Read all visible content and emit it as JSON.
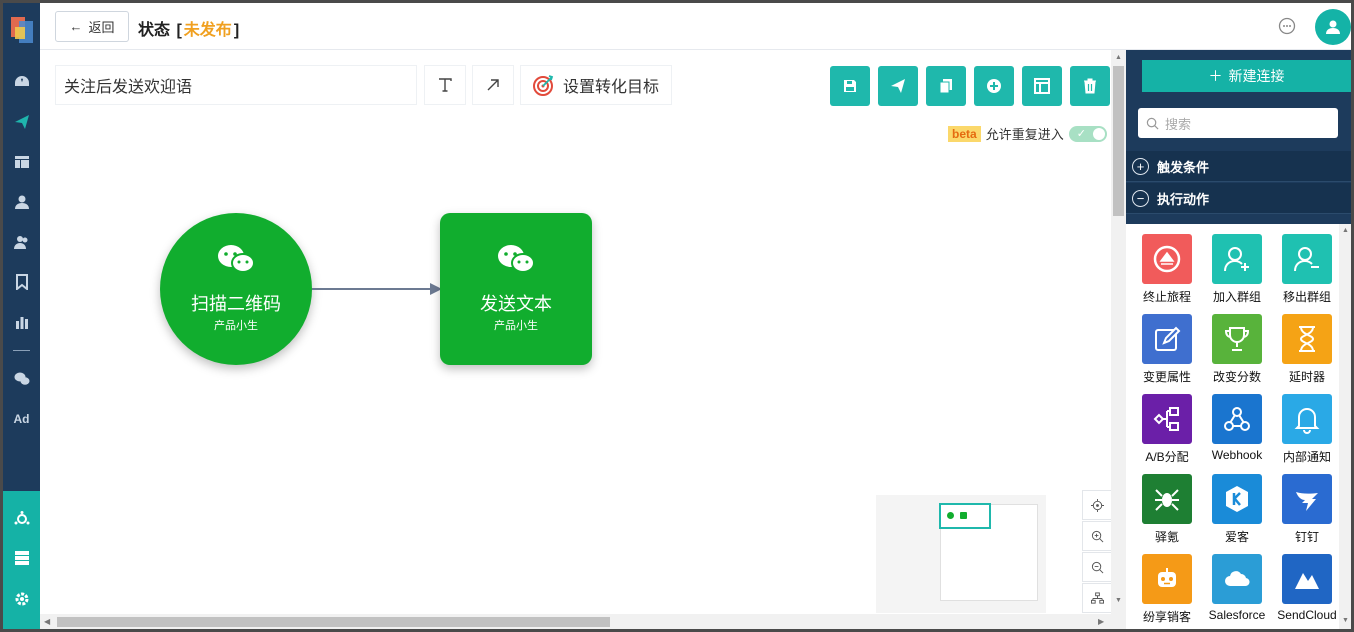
{
  "topbar": {
    "back_label": "返回",
    "status_label": "状态",
    "status_value": "未发布",
    "bracket_open": "[",
    "bracket_close": "]"
  },
  "nav": {
    "icons": [
      "dashboard-icon",
      "send-icon",
      "layout-icon",
      "user-icon",
      "users-icon",
      "bookmark-icon",
      "bar-chart-icon",
      "wechat-icon",
      "ad-icon",
      "connections-icon",
      "server-icon",
      "gear-icon"
    ],
    "ad_label": "Ad"
  },
  "canvas": {
    "flow_name": "关注后发送欢迎语",
    "goal_label": "设置转化目标",
    "beta_label": "beta",
    "reentry_label": "允许重复进入",
    "reentry_enabled": true,
    "nodes": [
      {
        "title": "扫描二维码",
        "subtitle": "产品小生",
        "shape": "circle"
      },
      {
        "title": "发送文本",
        "subtitle": "产品小生",
        "shape": "rect"
      }
    ],
    "toolbar_icons": [
      "save-icon",
      "publish-icon",
      "copy-icon",
      "add-icon",
      "template-icon",
      "delete-icon"
    ]
  },
  "right_panel": {
    "new_connection_label": "新建连接",
    "search_placeholder": "搜索",
    "sections": [
      {
        "label": "触发条件",
        "sign": "+"
      },
      {
        "label": "执行动作",
        "sign": "−"
      }
    ],
    "actions": [
      {
        "label": "终止旅程",
        "color": "#f15b5b",
        "icon": "stop-icon"
      },
      {
        "label": "加入群组",
        "color": "#1fc1b1",
        "icon": "user-add-icon"
      },
      {
        "label": "移出群组",
        "color": "#1fc1b1",
        "icon": "user-remove-icon"
      },
      {
        "label": "变更属性",
        "color": "#3f6fcf",
        "icon": "edit-icon"
      },
      {
        "label": "改变分数",
        "color": "#58b33b",
        "icon": "trophy-icon"
      },
      {
        "label": "延时器",
        "color": "#f5a315",
        "icon": "hourglass-icon"
      },
      {
        "label": "A/B分配",
        "color": "#6b1fa8",
        "icon": "ab-split-icon"
      },
      {
        "label": "Webhook",
        "color": "#1a75cf",
        "icon": "webhook-icon"
      },
      {
        "label": "内部通知",
        "color": "#2aa9e6",
        "icon": "bell-icon"
      },
      {
        "label": "驿氪",
        "color": "#1e7f33",
        "icon": "spider-icon"
      },
      {
        "label": "爱客",
        "color": "#1a8bd8",
        "icon": "k-icon"
      },
      {
        "label": "钉钉",
        "color": "#2a6bd1",
        "icon": "dingtalk-icon"
      },
      {
        "label": "纷享销客",
        "color": "#f59a17",
        "icon": "robot-icon"
      },
      {
        "label": "Salesforce",
        "color": "#2b9dd6",
        "icon": "cloud-icon"
      },
      {
        "label": "SendCloud",
        "color": "#2066c4",
        "icon": "sendcloud-icon"
      }
    ]
  }
}
